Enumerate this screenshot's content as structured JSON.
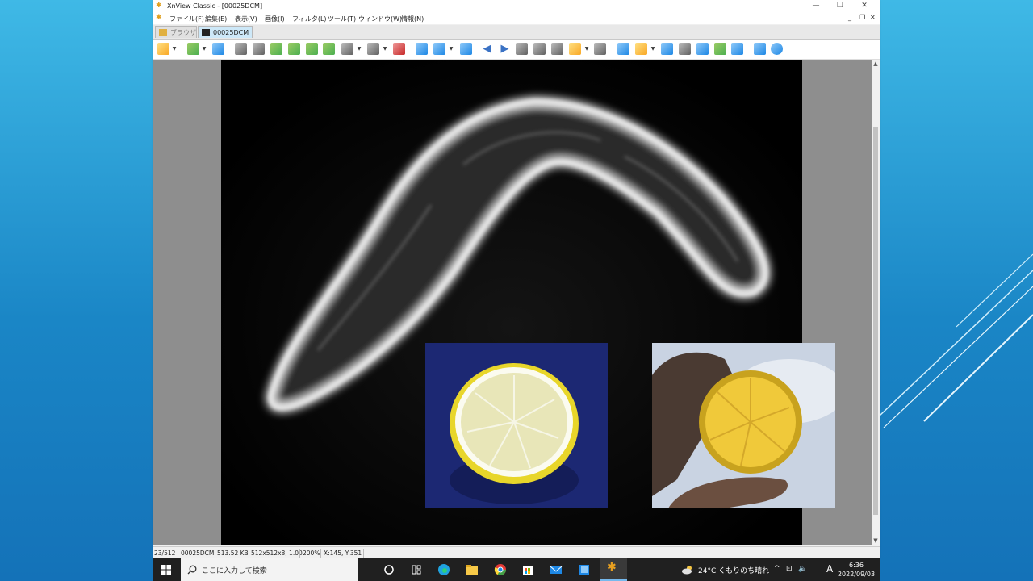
{
  "window": {
    "title": "XnView Classic - [00025DCM]",
    "controls": {
      "minimize": "—",
      "restore": "❐",
      "close": "✕"
    },
    "mdi_controls": {
      "minimize": "_",
      "restore": "❐",
      "close": "✕"
    }
  },
  "menu": [
    "ファイル(F)",
    "編集(E)",
    "表示(V)",
    "画像(I)",
    "フィルタ(L)",
    "ツール(T)",
    "ウィンドウ(W)",
    "情報(N)"
  ],
  "tabs": [
    {
      "label": "ブラウザ",
      "active": false
    },
    {
      "label": "00025DCM",
      "active": true
    }
  ],
  "status": {
    "index": "23/512",
    "filename": "00025DCM",
    "filesize": "513.52 KB",
    "dimensions": "512x512x8, 1.00",
    "zoom": "200%",
    "cursor": "X:145, Y:351"
  },
  "taskbar": {
    "search_placeholder": "ここに入力して検索",
    "weather": "24°C くもりのち晴れ",
    "ime": "A",
    "time": "6:36",
    "date": "2022/09/03"
  },
  "colors": {
    "accent": "#0078d7",
    "tab_active": "#cde8f8",
    "background_top": "#3fb9e6",
    "background_bottom": "#1472b8"
  }
}
